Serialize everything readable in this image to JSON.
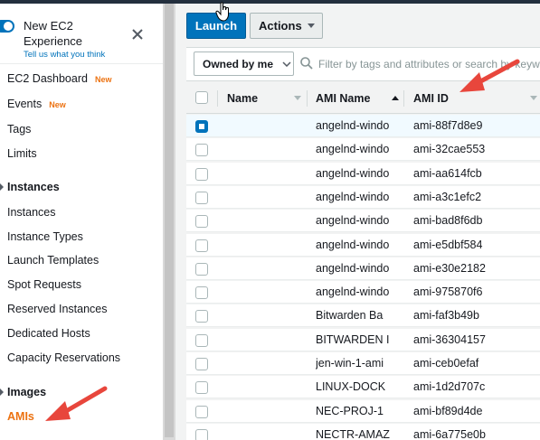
{
  "sidebar": {
    "experience_title": "New EC2 Experience",
    "experience_link": "Tell us what you think",
    "new_badge": "New",
    "items": [
      {
        "label": "EC2 Dashboard",
        "badge": "New"
      },
      {
        "label": "Events",
        "badge": "New"
      },
      {
        "label": "Tags"
      },
      {
        "label": "Limits"
      }
    ],
    "section_instances": "Instances",
    "instances_items": [
      "Instances",
      "Instance Types",
      "Launch Templates",
      "Spot Requests",
      "Reserved Instances",
      "Dedicated Hosts",
      "Capacity Reservations"
    ],
    "section_images": "Images",
    "images_items": [
      "AMIs"
    ]
  },
  "toolbar": {
    "launch_label": "Launch",
    "actions_label": "Actions"
  },
  "filter": {
    "owned_label": "Owned by me",
    "search_placeholder": "Filter by tags and attributes or search by keyword"
  },
  "table": {
    "columns": [
      "Name",
      "AMI Name",
      "AMI ID"
    ],
    "rows": [
      {
        "name": "",
        "ami_name": "angelnd-windo",
        "ami_id": "ami-88f7d8e9",
        "selected": true
      },
      {
        "name": "",
        "ami_name": "angelnd-windo",
        "ami_id": "ami-32cae553",
        "selected": false
      },
      {
        "name": "",
        "ami_name": "angelnd-windo",
        "ami_id": "ami-aa614fcb",
        "selected": false
      },
      {
        "name": "",
        "ami_name": "angelnd-windo",
        "ami_id": "ami-a3c1efc2",
        "selected": false
      },
      {
        "name": "",
        "ami_name": "angelnd-windo",
        "ami_id": "ami-bad8f6db",
        "selected": false
      },
      {
        "name": "",
        "ami_name": "angelnd-windo",
        "ami_id": "ami-e5dbf584",
        "selected": false
      },
      {
        "name": "",
        "ami_name": "angelnd-windo",
        "ami_id": "ami-e30e2182",
        "selected": false
      },
      {
        "name": "",
        "ami_name": "angelnd-windo",
        "ami_id": "ami-975870f6",
        "selected": false
      },
      {
        "name": "",
        "ami_name": "Bitwarden Ba",
        "ami_id": "ami-faf3b49b",
        "selected": false
      },
      {
        "name": "",
        "ami_name": "BITWARDEN I",
        "ami_id": "ami-36304157",
        "selected": false
      },
      {
        "name": "",
        "ami_name": "jen-win-1-ami",
        "ami_id": "ami-ceb0efaf",
        "selected": false
      },
      {
        "name": "",
        "ami_name": "LINUX-DOCK",
        "ami_id": "ami-1d2d707c",
        "selected": false
      },
      {
        "name": "",
        "ami_name": "NEC-PROJ-1",
        "ami_id": "ami-bf89d4de",
        "selected": false
      },
      {
        "name": "",
        "ami_name": "NECTR-AMAZ",
        "ami_id": "ami-6a775e0b",
        "selected": false
      }
    ]
  },
  "colors": {
    "accent": "#0073bb",
    "active_nav": "#ec7211",
    "annotation_arrow": "#e8463c"
  }
}
